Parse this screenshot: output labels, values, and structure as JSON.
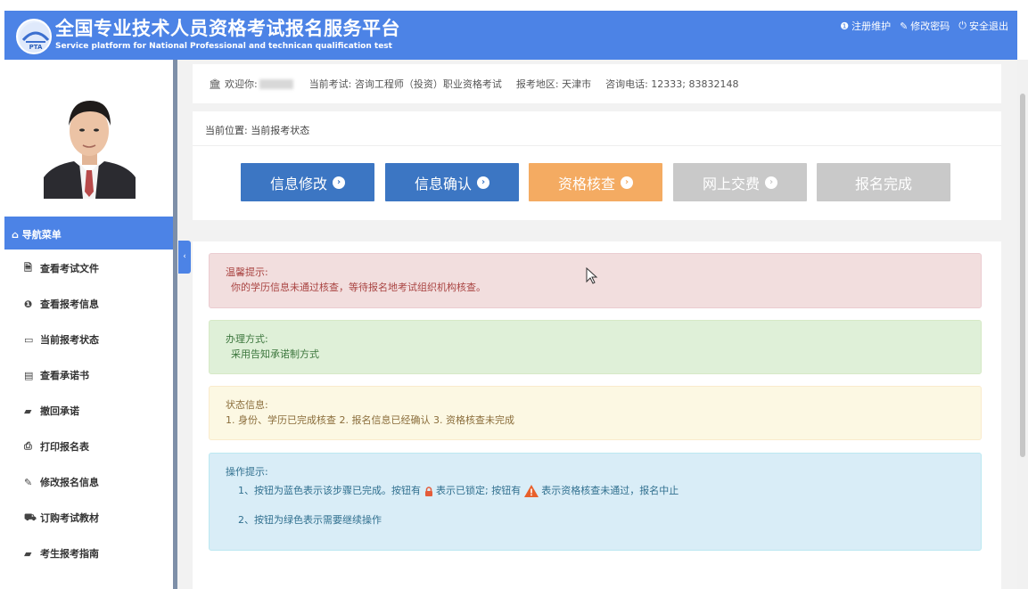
{
  "header": {
    "title_cn": "全国专业技术人员资格考试报名服务平台",
    "title_en": "Service platform for National Professional and technican qualification test",
    "logo_text": "PTA",
    "links": [
      {
        "label": "注册维护",
        "icon": "info-circle-icon"
      },
      {
        "label": "修改密码",
        "icon": "edit-icon"
      },
      {
        "label": "安全退出",
        "icon": "power-icon"
      }
    ]
  },
  "welcome": {
    "greeting": "欢迎你:",
    "exam": "当前考试: 咨询工程师（投资）职业资格考试",
    "region": "报考地区: 天津市",
    "phone": "咨询电话: 12333; 83832148"
  },
  "breadcrumb": "当前位置: 当前报考状态",
  "steps": [
    {
      "label": "信息修改",
      "color": "#3c76c3",
      "arrow": true
    },
    {
      "label": "信息确认",
      "color": "#3c76c3",
      "arrow": true
    },
    {
      "label": "资格核查",
      "color": "#f4ab62",
      "arrow": true
    },
    {
      "label": "网上交费",
      "color": "#c9c9c9",
      "arrow": true
    },
    {
      "label": "报名完成",
      "color": "#c9c9c9",
      "arrow": false
    }
  ],
  "sidebar": {
    "nav_title": "导航菜单",
    "items": [
      {
        "label": "查看考试文件",
        "icon": "document-icon"
      },
      {
        "label": "查看报考信息",
        "icon": "info-icon"
      },
      {
        "label": "当前报考状态",
        "icon": "monitor-icon"
      },
      {
        "label": "查看承诺书",
        "icon": "id-card-icon"
      },
      {
        "label": "撤回承诺",
        "icon": "book-icon"
      },
      {
        "label": "打印报名表",
        "icon": "print-icon"
      },
      {
        "label": "修改报名信息",
        "icon": "edit-icon"
      },
      {
        "label": "订购考试教材",
        "icon": "cart-icon"
      },
      {
        "label": "考生报考指南",
        "icon": "book-icon"
      }
    ]
  },
  "alerts": {
    "tip": {
      "title": "温馨提示:",
      "body": "你的学历信息未通过核查，等待报名地考试组织机构核查。",
      "bg": "#f2dede",
      "border": "#ebccd1",
      "color": "#a94442"
    },
    "method": {
      "title": "办理方式:",
      "body": "采用告知承诺制方式",
      "bg": "#dff0d8",
      "border": "#d6e9c6",
      "color": "#3c763d"
    },
    "status": {
      "title": "状态信息:",
      "body": "1. 身份、学历已完成核查 2. 报名信息已经确认 3. 资格核查未完成",
      "bg": "#fcf8e3",
      "border": "#faebcc",
      "color": "#8a6d3b"
    },
    "ops": {
      "title": "操作提示:",
      "line1a": "1、按钮为蓝色表示该步骤已完成。按钮有",
      "line1b": "表示已锁定; 按钮有",
      "line1c": "表示资格核查未通过，报名中止",
      "line2": "2、按钮为绿色表示需要继续操作",
      "bg": "#d9edf7",
      "border": "#bce8f1",
      "color": "#31708f"
    }
  }
}
